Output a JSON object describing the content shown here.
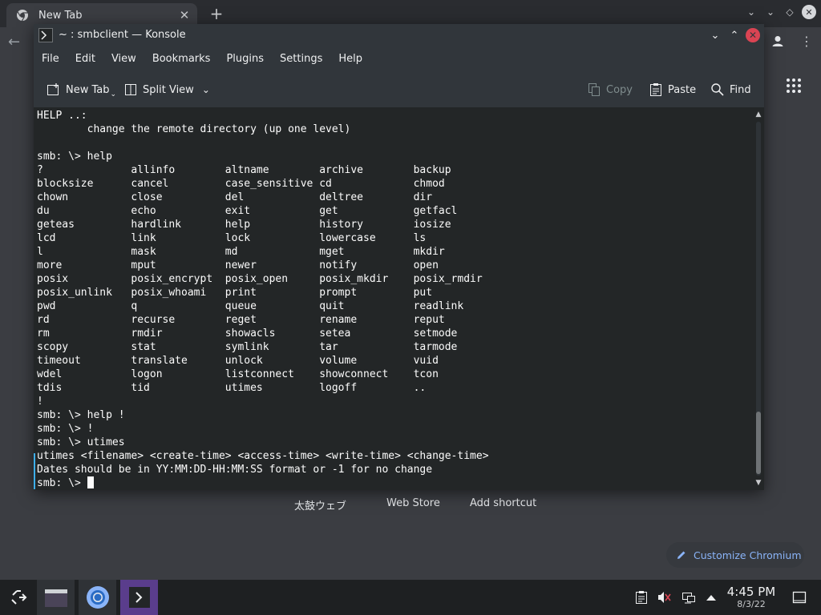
{
  "browser": {
    "tab_title": "New Tab",
    "tab_close": "✕",
    "new_tab": "+",
    "shortcuts": [
      "太鼓ウェブ",
      "Web Store",
      "Add shortcut"
    ],
    "customize_label": "Customize Chromium"
  },
  "konsole": {
    "title": "~ : smbclient — Konsole",
    "menu": [
      "File",
      "Edit",
      "View",
      "Bookmarks",
      "Plugins",
      "Settings",
      "Help"
    ],
    "toolbar": {
      "new_tab": "New Tab",
      "split_view": "Split View",
      "copy": "Copy",
      "paste": "Paste",
      "find": "Find"
    },
    "terminal_lines": [
      "HELP ..:",
      "        change the remote directory (up one level)",
      "",
      "smb: \\> help",
      "?              allinfo        altname        archive        backup",
      "blocksize      cancel         case_sensitive cd             chmod",
      "chown          close          del            deltree        dir",
      "du             echo           exit           get            getfacl",
      "geteas         hardlink       help           history        iosize",
      "lcd            link           lock           lowercase      ls",
      "l              mask           md             mget           mkdir",
      "more           mput           newer          notify         open",
      "posix          posix_encrypt  posix_open     posix_mkdir    posix_rmdir",
      "posix_unlink   posix_whoami   print          prompt         put",
      "pwd            q              queue          quit           readlink",
      "rd             recurse        reget          rename         reput",
      "rm             rmdir          showacls       setea          setmode",
      "scopy          stat           symlink        tar            tarmode",
      "timeout        translate      unlock         volume         vuid",
      "wdel           logon          listconnect    showconnect    tcon",
      "tdis           tid            utimes         logoff         ..",
      "!",
      "smb: \\> help !",
      "smb: \\> !",
      "smb: \\> utimes",
      "utimes <filename> <create-time> <access-time> <write-time> <change-time>",
      "Dates should be in YY:MM:DD-HH:MM:SS format or -1 for no change"
    ],
    "prompt": "smb: \\> "
  },
  "taskbar": {
    "time": "4:45 PM",
    "date": "8/3/22"
  },
  "colors": {
    "accent": "#3daee9",
    "close_button": "#da4453",
    "link_blue": "#8ab4f8",
    "active_task": "#5a3d8c"
  }
}
